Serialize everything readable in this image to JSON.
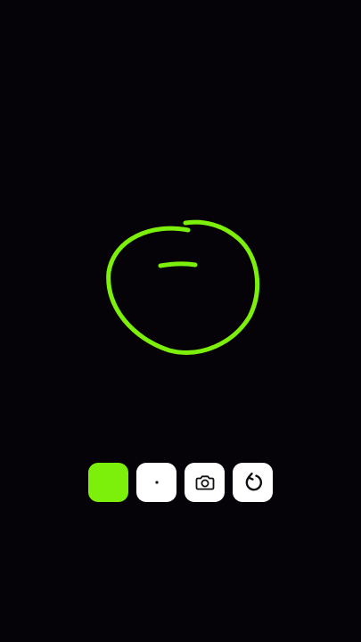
{
  "app": {
    "background_color": "#050308",
    "stroke_color": "#7CF00A"
  },
  "toolbar": {
    "color_swatch": {
      "color": "#7CF00A",
      "icon": "color-swatch"
    },
    "brush_size": {
      "icon": "brush-dot-icon"
    },
    "camera": {
      "icon": "camera-icon"
    },
    "undo": {
      "icon": "undo-icon"
    }
  }
}
